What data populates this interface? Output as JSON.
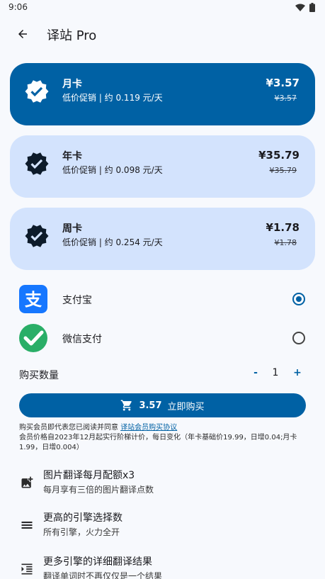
{
  "status_bar": {
    "time": "9:06"
  },
  "app_bar": {
    "title": "译站 Pro"
  },
  "plans": [
    {
      "name": "月卡",
      "desc": "低价促销 | 约 0.119 元/天",
      "price": "¥3.57",
      "original_price": "¥3.57",
      "selected": true
    },
    {
      "name": "年卡",
      "desc": "低价促销 | 约 0.098 元/天",
      "price": "¥35.79",
      "original_price": "¥35.79",
      "selected": false
    },
    {
      "name": "周卡",
      "desc": "低价促销 | 约 0.254 元/天",
      "price": "¥1.78",
      "original_price": "¥1.78",
      "selected": false
    }
  ],
  "payment": {
    "alipay_label": "支付宝",
    "wechat_label": "微信支付",
    "selected": "alipay"
  },
  "quantity": {
    "label": "购买数量",
    "minus": "-",
    "value": "1",
    "plus": "+"
  },
  "buy_button": {
    "amount": "3.57",
    "label": "立即购买"
  },
  "agreement": {
    "prefix": "购买会员即代表您已阅读并同意 ",
    "link": "译站会员购买协议",
    "note": "会员价格自2023年12月起实行阶梯计价，每日变化（年卡基础价19.99，日增0.04;月卡1.99，日增0.004）"
  },
  "features": [
    {
      "icon": "add-photo-icon",
      "title": "图片翻译每月配额x3",
      "subtitle": "每月享有三倍的图片翻译点数"
    },
    {
      "icon": "menu-lines-icon",
      "title": "更高的引擎选择数",
      "subtitle": "所有引擎，火力全开"
    },
    {
      "icon": "format-indent-icon",
      "title": "更多引擎的详细翻译结果",
      "subtitle": "翻译单词时不再仅仅是一个结果"
    }
  ],
  "colors": {
    "primary": "#0061a4",
    "card_light": "#d3e3fd",
    "alipay": "#1677ff",
    "wechat": "#2aae67"
  }
}
